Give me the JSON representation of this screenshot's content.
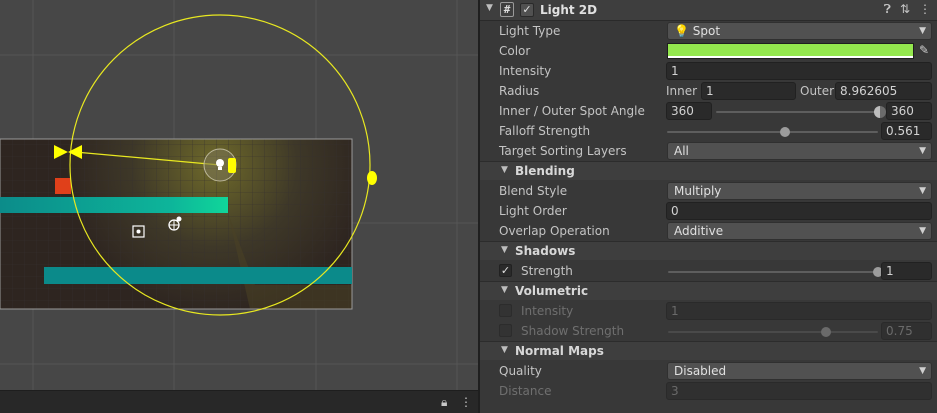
{
  "component": {
    "title": "Light 2D",
    "enabled_mark": "✓",
    "icons": [
      "help-icon",
      "presets-icon",
      "kebab-menu-icon"
    ]
  },
  "properties": {
    "light_type": {
      "label": "Light Type",
      "value": "Spot",
      "icon": "💡"
    },
    "color": {
      "label": "Color",
      "hex": "#94e74e"
    },
    "intensity": {
      "label": "Intensity",
      "value": "1"
    },
    "radius": {
      "label": "Radius",
      "inner_label": "Inner",
      "inner": "1",
      "outer_label": "Outer",
      "outer": "8.962605"
    },
    "spot_angle": {
      "label": "Inner / Outer Spot Angle",
      "inner": "360",
      "outer": "360"
    },
    "falloff": {
      "label": "Falloff Strength",
      "value": "0.561",
      "fraction": 0.561
    },
    "sorting_layers": {
      "label": "Target Sorting Layers",
      "value": "All"
    }
  },
  "blending": {
    "title": "Blending",
    "blend_style": {
      "label": "Blend Style",
      "value": "Multiply"
    },
    "light_order": {
      "label": "Light Order",
      "value": "0"
    },
    "overlap": {
      "label": "Overlap Operation",
      "value": "Additive"
    }
  },
  "shadows": {
    "title": "Shadows",
    "strength": {
      "label": "Strength",
      "checked": "✓",
      "value": "1",
      "fraction": 1.0
    }
  },
  "volumetric": {
    "title": "Volumetric",
    "intensity": {
      "label": "Intensity",
      "value": "1"
    },
    "shadow_strength": {
      "label": "Shadow Strength",
      "value": "0.75",
      "fraction": 0.75
    }
  },
  "normal_maps": {
    "title": "Normal Maps",
    "quality": {
      "label": "Quality",
      "value": "Disabled"
    },
    "distance": {
      "label": "Distance",
      "value": "3"
    }
  },
  "scene": {
    "footer_icons": [
      "lock-icon",
      "kebab-menu-icon"
    ],
    "gizmo_color": "#ffff00",
    "platform_color": "#0b8a8a"
  }
}
